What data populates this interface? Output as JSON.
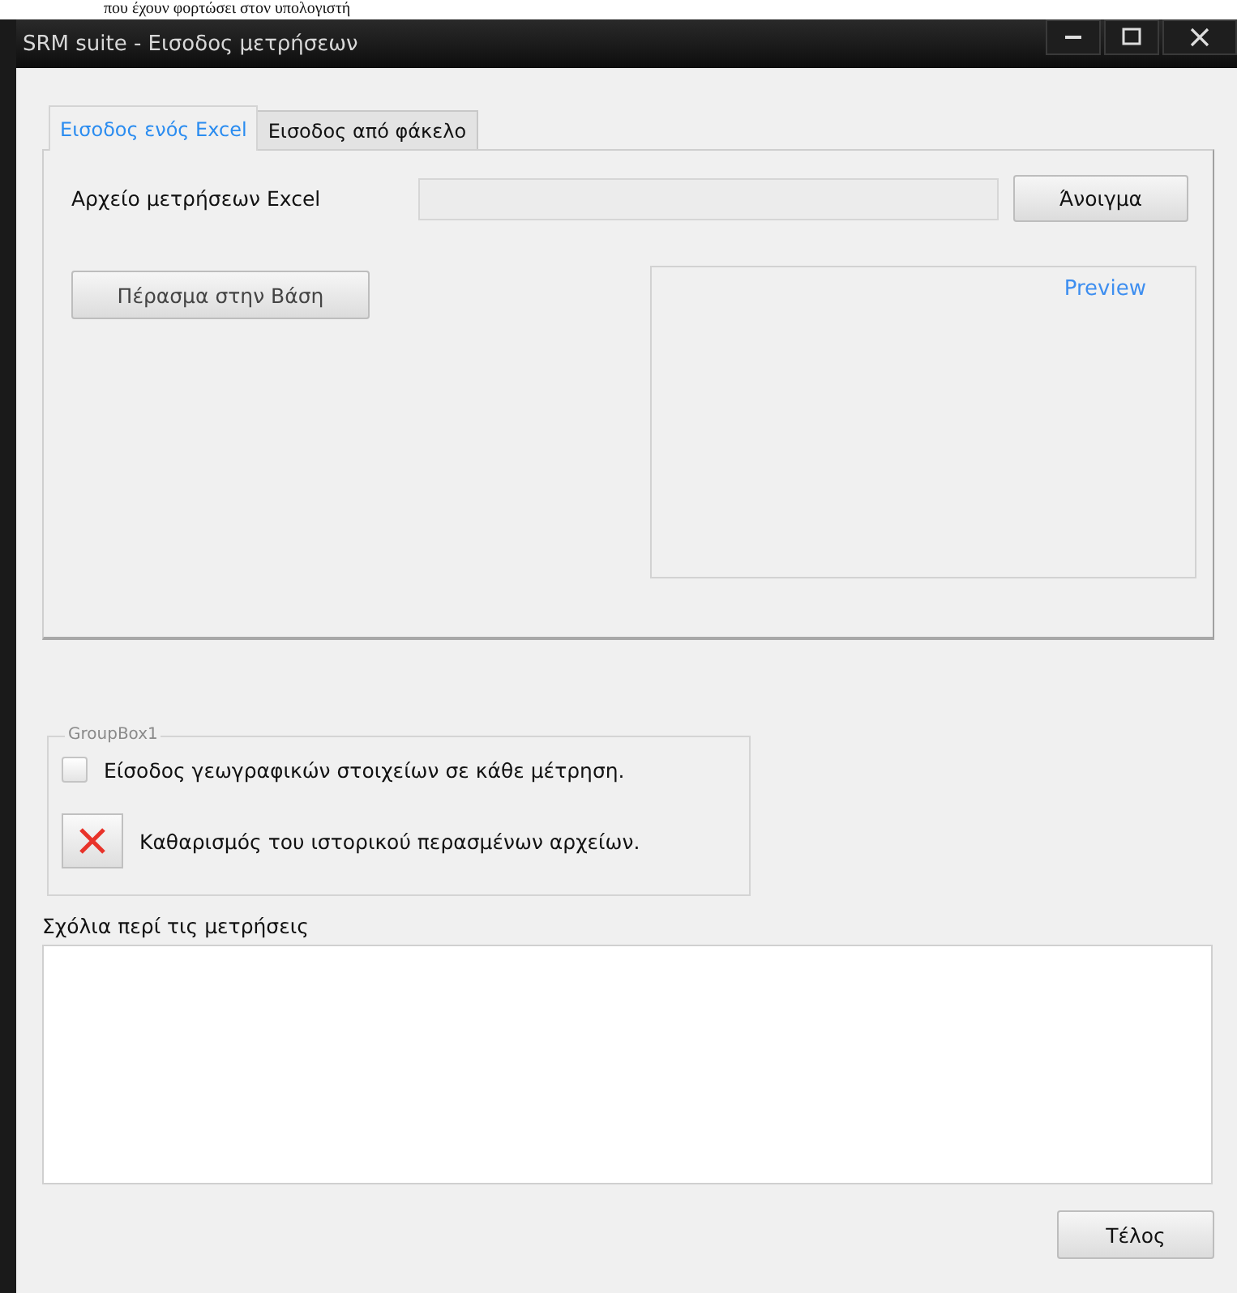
{
  "caption": "που έχουν φορτώσει στον υπολογιστή",
  "window": {
    "title": "SRM suite - Εισοδος μετρήσεων"
  },
  "tabs": [
    {
      "label": "Εισοδος ενός Excel",
      "selected": true
    },
    {
      "label": "Εισοδος από φάκελο",
      "selected": false
    }
  ],
  "file_field": {
    "label": "Αρχείο μετρήσεων Excel",
    "disabled": true
  },
  "open_button": "Άνοιγμα",
  "import_button": "Πέρασμα στην Βάση",
  "preview": {
    "label": "Preview"
  },
  "group_box": {
    "title": "GroupBox1"
  },
  "geo_checkbox": {
    "label": "Είσοδος γεωγραφικών στοιχείων σε κάθε μέτρηση.",
    "checked": false
  },
  "clear_history": {
    "label": "Καθαρισμός του ιστορικού περασμένων αρχείων."
  },
  "comments": {
    "label": "Σχόλια περί τις μετρήσεις"
  },
  "finish_button": "Τέλος"
}
